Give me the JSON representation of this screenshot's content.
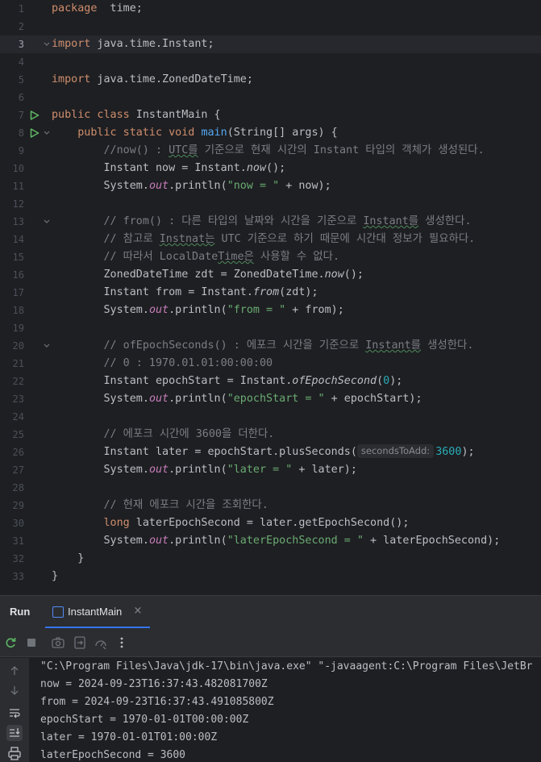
{
  "editor": {
    "lines": [
      {
        "n": "1",
        "segs": [
          [
            "kw",
            "package"
          ],
          [
            "",
            "  time;"
          ]
        ]
      },
      {
        "n": "2",
        "segs": []
      },
      {
        "n": "3",
        "current": true,
        "fold": true,
        "segs": [
          [
            "kw",
            "import"
          ],
          [
            "",
            " java.time.Instant;"
          ]
        ]
      },
      {
        "n": "4",
        "segs": []
      },
      {
        "n": "5",
        "segs": [
          [
            "kw",
            "import"
          ],
          [
            "",
            " java.time.ZonedDateTime;"
          ]
        ]
      },
      {
        "n": "6",
        "segs": []
      },
      {
        "n": "7",
        "run": true,
        "segs": [
          [
            "kw",
            "public class"
          ],
          [
            "",
            " InstantMain {"
          ]
        ]
      },
      {
        "n": "8",
        "run": true,
        "fold": true,
        "segs": [
          [
            "",
            "    "
          ],
          [
            "kw",
            "public static void"
          ],
          [
            "",
            " "
          ],
          [
            "fn",
            "main"
          ],
          [
            "",
            "(String[] args) {"
          ]
        ]
      },
      {
        "n": "9",
        "segs": [
          [
            "",
            "        "
          ],
          [
            "cmt",
            "//now() : "
          ],
          [
            "cmt typo",
            "UTC를"
          ],
          [
            "cmt",
            " 기준으로 현재 시간의 Instant 타입의 객체가 생성된다."
          ]
        ]
      },
      {
        "n": "10",
        "segs": [
          [
            "",
            "        Instant now = Instant."
          ],
          [
            "st",
            "now"
          ],
          [
            "",
            "();"
          ]
        ]
      },
      {
        "n": "11",
        "segs": [
          [
            "",
            "        System."
          ],
          [
            "fld",
            "out"
          ],
          [
            "",
            ".println("
          ],
          [
            "str",
            "\"now = \""
          ],
          [
            "",
            " + now);"
          ]
        ]
      },
      {
        "n": "12",
        "segs": []
      },
      {
        "n": "13",
        "fold": true,
        "segs": [
          [
            "",
            "        "
          ],
          [
            "cmt",
            "// from() : 다른 타입의 날짜와 시간을 기준으로 "
          ],
          [
            "cmt typo",
            "Instant를"
          ],
          [
            "cmt",
            " 생성한다."
          ]
        ]
      },
      {
        "n": "14",
        "segs": [
          [
            "",
            "        "
          ],
          [
            "cmt",
            "// 참고로 "
          ],
          [
            "cmt typo",
            "Instnat는"
          ],
          [
            "cmt",
            " UTC 기준으로 하기 때문에 시간대 정보가 필요하다."
          ]
        ]
      },
      {
        "n": "15",
        "segs": [
          [
            "",
            "        "
          ],
          [
            "cmt",
            "// 따라서 LocalDate"
          ],
          [
            "cmt typo",
            "Time은"
          ],
          [
            "cmt",
            " 사용할 수 없다."
          ]
        ]
      },
      {
        "n": "16",
        "segs": [
          [
            "",
            "        ZonedDateTime zdt = ZonedDateTime."
          ],
          [
            "st",
            "now"
          ],
          [
            "",
            "();"
          ]
        ]
      },
      {
        "n": "17",
        "segs": [
          [
            "",
            "        Instant from = Instant."
          ],
          [
            "st",
            "from"
          ],
          [
            "",
            "(zdt);"
          ]
        ]
      },
      {
        "n": "18",
        "segs": [
          [
            "",
            "        System."
          ],
          [
            "fld",
            "out"
          ],
          [
            "",
            ".println("
          ],
          [
            "str",
            "\"from = \""
          ],
          [
            "",
            " + from);"
          ]
        ]
      },
      {
        "n": "19",
        "segs": []
      },
      {
        "n": "20",
        "fold": true,
        "segs": [
          [
            "",
            "        "
          ],
          [
            "cmt",
            "// ofEpochSeconds() : 에포크 시간을 기준으로 "
          ],
          [
            "cmt typo",
            "Instant를"
          ],
          [
            "cmt",
            " 생성한다."
          ]
        ]
      },
      {
        "n": "21",
        "segs": [
          [
            "",
            "        "
          ],
          [
            "cmt",
            "// 0 : 1970.01.01:00:00:00"
          ]
        ]
      },
      {
        "n": "22",
        "segs": [
          [
            "",
            "        Instant epochStart = Instant."
          ],
          [
            "st",
            "ofEpochSecond"
          ],
          [
            "",
            "("
          ],
          [
            "num",
            "0"
          ],
          [
            "",
            ");"
          ]
        ]
      },
      {
        "n": "23",
        "segs": [
          [
            "",
            "        System."
          ],
          [
            "fld",
            "out"
          ],
          [
            "",
            ".println("
          ],
          [
            "str",
            "\"epochStart = \""
          ],
          [
            "",
            " + epochStart);"
          ]
        ]
      },
      {
        "n": "24",
        "segs": []
      },
      {
        "n": "25",
        "segs": [
          [
            "",
            "        "
          ],
          [
            "cmt",
            "// 에포크 시간에 3600을 더한다."
          ]
        ]
      },
      {
        "n": "26",
        "segs": [
          [
            "",
            "        Instant later = epochStart.plusSeconds("
          ],
          [
            "hint",
            "secondsToAdd:"
          ],
          [
            "num",
            "3600"
          ],
          [
            "",
            ");"
          ]
        ]
      },
      {
        "n": "27",
        "segs": [
          [
            "",
            "        System."
          ],
          [
            "fld",
            "out"
          ],
          [
            "",
            ".println("
          ],
          [
            "str",
            "\"later = \""
          ],
          [
            "",
            " + later);"
          ]
        ]
      },
      {
        "n": "28",
        "segs": []
      },
      {
        "n": "29",
        "segs": [
          [
            "",
            "        "
          ],
          [
            "cmt",
            "// 현재 에포크 시간을 조회한다."
          ]
        ]
      },
      {
        "n": "30",
        "segs": [
          [
            "",
            "        "
          ],
          [
            "kw",
            "long"
          ],
          [
            "",
            " laterEpochSecond = later.getEpochSecond();"
          ]
        ]
      },
      {
        "n": "31",
        "segs": [
          [
            "",
            "        System."
          ],
          [
            "fld",
            "out"
          ],
          [
            "",
            ".println("
          ],
          [
            "str",
            "\"laterEpochSecond = \""
          ],
          [
            "",
            " + laterEpochSecond);"
          ]
        ]
      },
      {
        "n": "32",
        "segs": [
          [
            "",
            "    }"
          ]
        ]
      },
      {
        "n": "33",
        "segs": [
          [
            "",
            "}"
          ]
        ]
      }
    ]
  },
  "run_panel": {
    "title": "Run",
    "tab_label": "InstantMain",
    "tab_close": "×",
    "toolbar_icons": [
      "rerun-icon",
      "stop-icon",
      "screenshot-icon",
      "restore-layout-icon",
      "profiler-icon",
      "more-icon"
    ],
    "side_icons": [
      "scroll-up-icon",
      "scroll-down-icon",
      "soft-wrap-icon",
      "scroll-to-end-icon",
      "print-icon"
    ],
    "console": [
      "\"C:\\Program Files\\Java\\jdk-17\\bin\\java.exe\" \"-javaagent:C:\\Program Files\\JetBr",
      "now = 2024-09-23T16:37:43.482081700Z",
      "from = 2024-09-23T16:37:43.491085800Z",
      "epochStart = 1970-01-01T00:00:00Z",
      "later = 1970-01-01T01:00:00Z",
      "laterEpochSecond = 3600"
    ]
  },
  "colors": {
    "background": "#1e1f22",
    "keyword": "#cf8e6d",
    "method": "#56a8f5",
    "string": "#6aab73",
    "number": "#2aacb8",
    "comment": "#7a7e85",
    "field": "#c77dbb",
    "run_gutter": "#5fb865",
    "accent": "#3574f0"
  }
}
